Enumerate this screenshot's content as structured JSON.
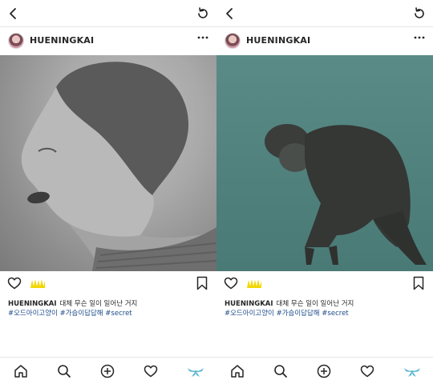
{
  "screens": [
    {
      "username": "HUENINGKAI",
      "caption_text": "대체 무슨 일이 일어난 거지",
      "hashtags": "#오드아이고양이 #가슴이답답해 #secret"
    },
    {
      "username": "HUENINGKAI",
      "caption_text": "대체 무슨 일이 일어난 거지",
      "hashtags": "#오드아이고양이 #가슴이답답해 #secret"
    }
  ],
  "icons": {
    "back": "chevron-left-icon",
    "refresh": "refresh-icon",
    "more": "more-horizontal-icon",
    "like": "heart-icon",
    "save": "bookmark-icon",
    "nav": [
      "home-icon",
      "search-icon",
      "add-icon",
      "activity-heart-icon",
      "profile-icon"
    ]
  },
  "colors": {
    "hashtag": "#1b4a8a",
    "sticker": "#f2d600",
    "active_nav": "#5bb8d0"
  }
}
